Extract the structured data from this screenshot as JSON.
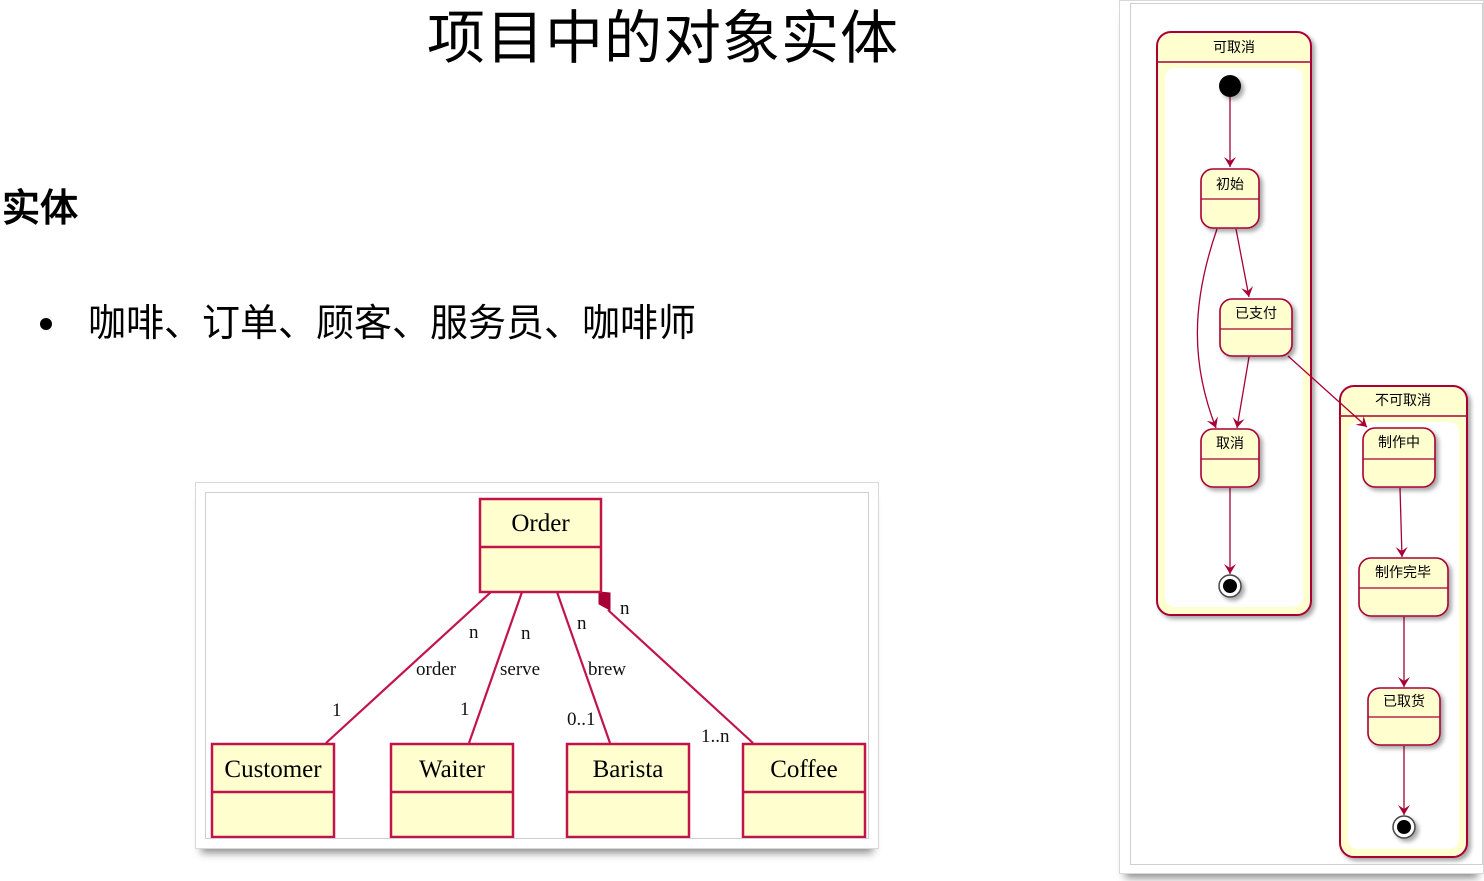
{
  "slide": {
    "title": "项目中的对象实体",
    "heading": "实体",
    "bullets": [
      "咖啡、订单、顾客、服务员、咖啡师"
    ]
  },
  "colors": {
    "line": "#a80036",
    "fill": "#fefece",
    "border": "#a80036",
    "text": "#000000"
  },
  "class_diagram": {
    "classes": {
      "order": "Order",
      "customer": "Customer",
      "waiter": "Waiter",
      "barista": "Barista",
      "coffee": "Coffee"
    },
    "associations": [
      {
        "from": "Order",
        "to": "Customer",
        "label": "order",
        "from_mult": "n",
        "to_mult": "1",
        "kind": "association"
      },
      {
        "from": "Order",
        "to": "Waiter",
        "label": "serve",
        "from_mult": "n",
        "to_mult": "1",
        "kind": "association"
      },
      {
        "from": "Order",
        "to": "Barista",
        "label": "brew",
        "from_mult": "n",
        "to_mult": "0..1",
        "kind": "association"
      },
      {
        "from": "Order",
        "to": "Coffee",
        "label": "",
        "from_mult": "n",
        "to_mult": "1..n",
        "kind": "composition"
      }
    ]
  },
  "state_diagram": {
    "composites": {
      "cancellable": "可取消",
      "non_cancellable": "不可取消"
    },
    "states": {
      "initial": "初始",
      "paid": "已支付",
      "cancelled": "取消",
      "making": "制作中",
      "made": "制作完毕",
      "picked_up": "已取货"
    },
    "transitions": [
      [
        "[*]",
        "初始"
      ],
      [
        "初始",
        "已支付"
      ],
      [
        "初始",
        "取消"
      ],
      [
        "已支付",
        "取消"
      ],
      [
        "已支付",
        "制作中"
      ],
      [
        "取消",
        "[*]"
      ],
      [
        "制作中",
        "制作完毕"
      ],
      [
        "制作完毕",
        "已取货"
      ],
      [
        "已取货",
        "[*]"
      ]
    ]
  }
}
